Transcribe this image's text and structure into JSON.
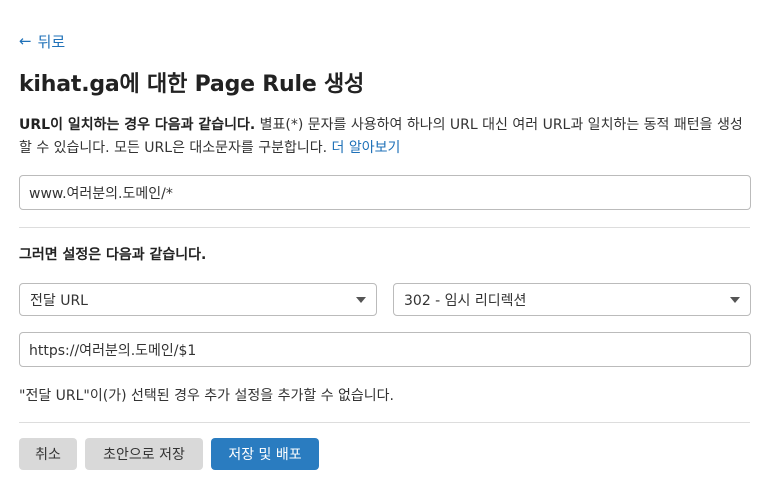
{
  "back": {
    "icon": "arrow-left-icon",
    "label": "뒤로"
  },
  "page": {
    "title": "kihat.ga에 대한 Page Rule 생성"
  },
  "description": {
    "bold": "URL이 일치하는 경우 다음과 같습니다.",
    "text": " 별표(*) 문자를 사용하여 하나의 URL 대신 여러 URL과 일치하는 동적 패턴을 생성할 수 있습니다. 모든 URL은 대소문자를 구분합니다. ",
    "link": "더 알아보기"
  },
  "url_match": {
    "value": "www.여러분의.도메인/*"
  },
  "settings": {
    "heading": "그러면 설정은 다음과 같습니다.",
    "setting_select": "전달 URL",
    "status_select": "302 - 임시 리디렉션",
    "destination_value": "https://여러분의.도메인/$1",
    "note": "\"전달 URL\"이(가) 선택된 경우 추가 설정을 추가할 수 없습니다."
  },
  "buttons": {
    "cancel": "취소",
    "save_draft": "초안으로 저장",
    "save_deploy": "저장 및 배포"
  },
  "colors": {
    "link": "#1f71b8",
    "primary_button": "#2a7cc0",
    "secondary_button": "#d9d9d9"
  }
}
